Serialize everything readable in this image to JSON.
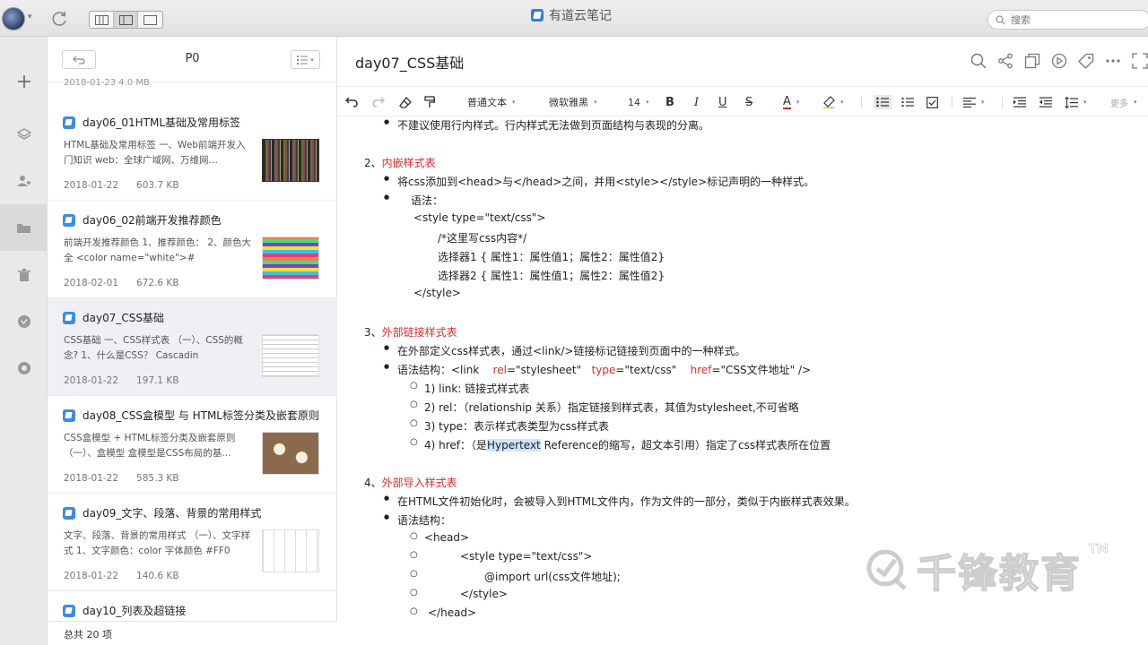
{
  "window": {
    "app_title": "有道云笔记"
  },
  "search": {
    "placeholder": "搜索"
  },
  "list": {
    "folder": "P0",
    "prev_meta": "2018-01-23    4.0 MB",
    "notes": [
      {
        "title": "day06_01HTML基础及常用标签",
        "snippet": "HTML基础及常用标签 一、Web前端开发入门知识 web：全球广域网、万维网…",
        "date": "2018-01-22",
        "size": "603.7 KB"
      },
      {
        "title": "day06_02前端开发推荐颜色",
        "snippet": "前端开发推荐颜色 1、推荐颜色： 2、颜色大全 <color name=\"white\">#",
        "date": "2018-02-01",
        "size": "672.6 KB"
      },
      {
        "title": "day07_CSS基础",
        "snippet": "CSS基础 一、CSS样式表 （一）、CSS的概念? 1、什么是CSS？ Cascadin",
        "date": "2018-01-22",
        "size": "197.1 KB"
      },
      {
        "title": "day08_CSS盒模型 与 HTML标签分类及嵌套原则",
        "snippet": "CSS盒模型 + HTML标签分类及嵌套原则 （一）、盒模型 盒模型是CSS布局的基…",
        "date": "2018-01-22",
        "size": "585.3 KB"
      },
      {
        "title": "day09_文字、段落、背景的常用样式",
        "snippet": "文字、段落、背景的常用样式 （一）、文字样式 1、文字颜色：color 字体颜色 #FF0",
        "date": "2018-01-22",
        "size": "140.6 KB"
      },
      {
        "title": "day10_列表及超链接",
        "snippet": "",
        "date": "",
        "size": ""
      }
    ],
    "footer": "总共 20 项"
  },
  "editor": {
    "title": "day07_CSS基础",
    "toolbar": {
      "style": "普通文本",
      "font": "微软雅黑",
      "size": "14",
      "bold": "B",
      "italic": "I",
      "underline": "U",
      "strike": "S",
      "color": "A",
      "more": "更多"
    },
    "lines": {
      "l0": "不建议使用行内样式。行内样式无法做到页面结构与表现的分离。",
      "h2_num": "2、",
      "h2": "内嵌样式表",
      "l2a": "将css添加到<head>与</head>之间，并用<style></style>标记声明的一种样式。",
      "l2b": "语法：",
      "l2c": "<style  type=\"text/css\">",
      "l2d": "/*这里写css内容*/",
      "l2e": "选择器1 { 属性1：属性值1；属性2：属性值2}",
      "l2f": "选择器2 { 属性1：属性值1；属性2：属性值2}",
      "l2g": "</style>",
      "h3_num": "3、",
      "h3": "外部链接样式表",
      "l3a": "在外部定义css样式表，通过<link/>链接标记链接到页面中的一种样式。",
      "l3b_pre": "语法结构：<link",
      "l3b_rel": "rel",
      "l3b_relv": "=\"stylesheet\"",
      "l3b_type": "type",
      "l3b_typev": "=\"text/css\"",
      "l3b_href": "href",
      "l3b_hrefv": "=\"CSS文件地址\" />",
      "l3c": "1) link: 链接式样式表",
      "l3d": "2) rel：（relationship 关系）指定链接到样式表，其值为stylesheet,不可省略",
      "l3e": "3) type：表示样式表类型为css样式表",
      "l3f_pre": "4) href：（是",
      "l3f_sel": "Hypertext",
      "l3f_post": " Reference的缩写，超文本引用）指定了css样式表所在位置",
      "h4_num": "4、",
      "h4": "外部导入样式表",
      "l4a": "在HTML文件初始化时，会被导入到HTML文件内，作为文件的一部分，类似于内嵌样式表效果。",
      "l4b": "语法结构：",
      "l4c": "<head>",
      "l4d": "<style type=\"text/css\">",
      "l4e": "@import url(css文件地址);",
      "l4f": "</style>",
      "l4g": "</head>"
    }
  },
  "watermark": {
    "text": "千锋教育",
    "tm": "TM"
  },
  "colors": {
    "accent": "#3a8be8",
    "heading_red": "#e02a2a"
  }
}
